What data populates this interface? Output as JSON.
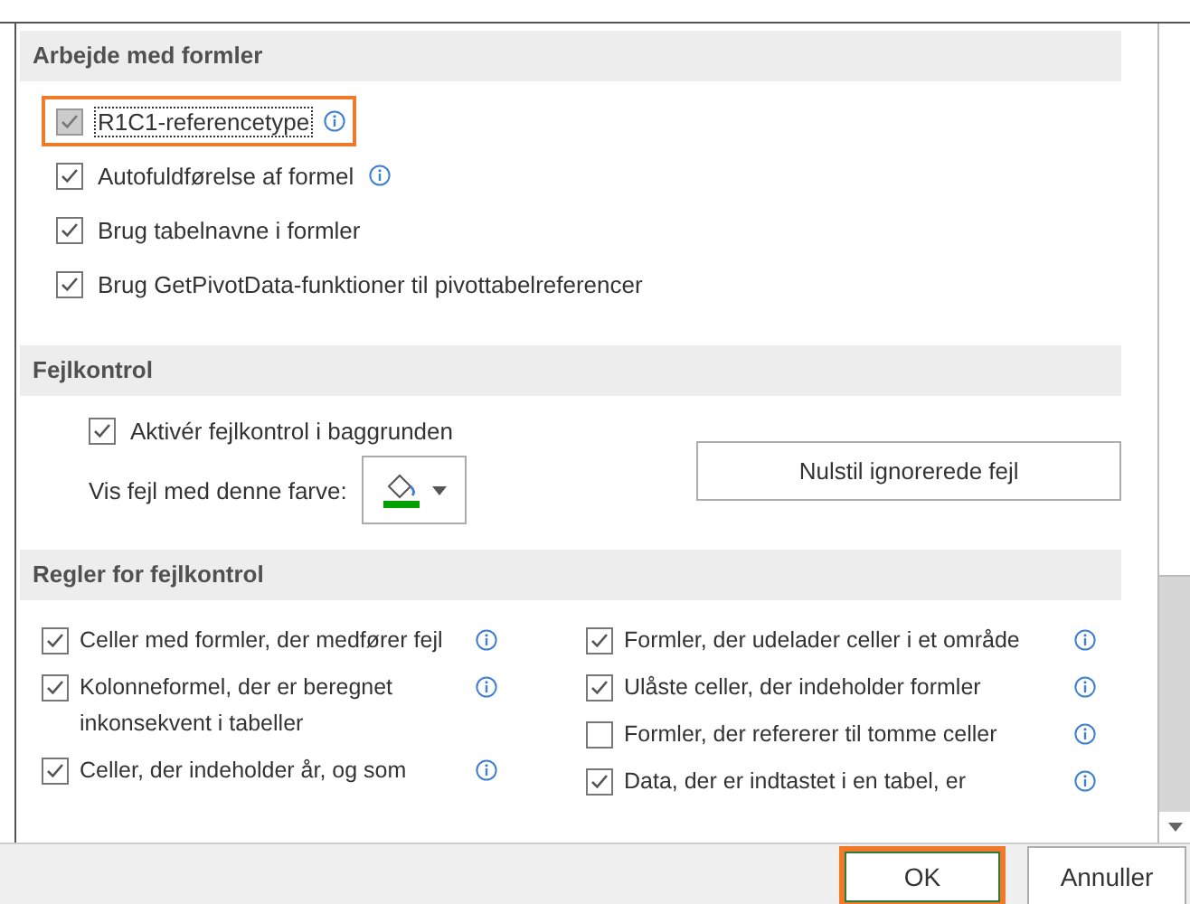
{
  "sections": [
    {
      "kind": "options",
      "title": "Arbejde med formler",
      "options": [
        {
          "label": "R1C1-referencetype",
          "checked": true,
          "focused": true,
          "highlighted": true,
          "info": true
        },
        {
          "label": "Autofuldførelse af formel",
          "checked": true,
          "focused": false,
          "highlighted": false,
          "info": true
        },
        {
          "label": "Brug tabelnavne i formler",
          "checked": true,
          "focused": false,
          "highlighted": false,
          "info": false
        },
        {
          "label": "Brug GetPivotData-funktioner til pivottabelreferencer",
          "checked": true,
          "focused": false,
          "highlighted": false,
          "info": false
        }
      ]
    },
    {
      "kind": "error_check",
      "title": "Fejlkontrol",
      "option": {
        "label": "Aktivér fejlkontrol i baggrunden",
        "checked": true
      },
      "color_label": "Vis fejl med denne farve:",
      "color": "#00a000",
      "reset_button": "Nulstil ignorerede fejl"
    },
    {
      "kind": "rules",
      "title": "Regler for fejlkontrol",
      "columns": [
        [
          {
            "label": "Celler med formler, der medfører fejl",
            "checked": true
          },
          {
            "label": "Kolonneformel, der er beregnet inkonsekvent i tabeller",
            "checked": true
          },
          {
            "label": "Celler, der indeholder år, og som",
            "checked": true
          }
        ],
        [
          {
            "label": "Formler, der udelader celler i et område",
            "checked": true
          },
          {
            "label": "Ulåste celler, der indeholder formler",
            "checked": true
          },
          {
            "label": "Formler, der refererer til tomme celler",
            "checked": false
          },
          {
            "label": "Data, der er indtastet i en tabel, er",
            "checked": true
          }
        ]
      ]
    }
  ],
  "buttons": [
    {
      "label": "OK",
      "highlighted": true
    },
    {
      "label": "Annuller",
      "highlighted": false
    }
  ]
}
